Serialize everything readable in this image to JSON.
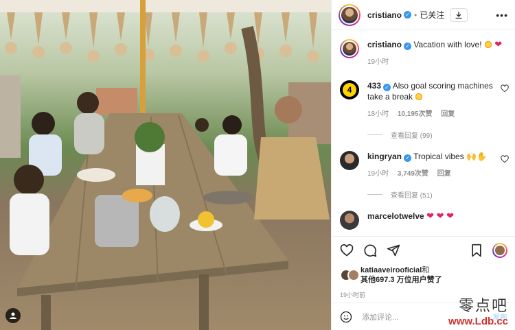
{
  "post": {
    "username": "cristiano",
    "following_label": "已关注",
    "more_label": "•••"
  },
  "caption": {
    "username": "cristiano",
    "text": "Vacation with love!",
    "time": "19小时"
  },
  "comments": [
    {
      "username": "433",
      "text": "Also goal scoring machines take a break",
      "time": "18小时",
      "likes": "10,195次赞",
      "reply": "回复",
      "view_replies": "查看回复 (99)"
    },
    {
      "username": "kingryan",
      "text": "Tropical vibes",
      "time": "19小时",
      "likes": "3,749次赞",
      "reply": "回复",
      "view_replies": "查看回复 (51)"
    },
    {
      "username": "marcelotwelve",
      "text": ""
    }
  ],
  "likes": {
    "first_user": "katiaaveirooficial",
    "and_label": "和",
    "others": "其他697.3 万位用户赞了"
  },
  "posted_time": "19小时前",
  "add_comment": {
    "placeholder": "添加评论...",
    "post_label": "发布"
  },
  "watermark": {
    "line1": "零点吧",
    "line2": "www.Ldb.cc"
  },
  "colors": {
    "verified": "#3897f0",
    "accent_heart": "#e0245e",
    "post_button": "#b2dffc"
  }
}
